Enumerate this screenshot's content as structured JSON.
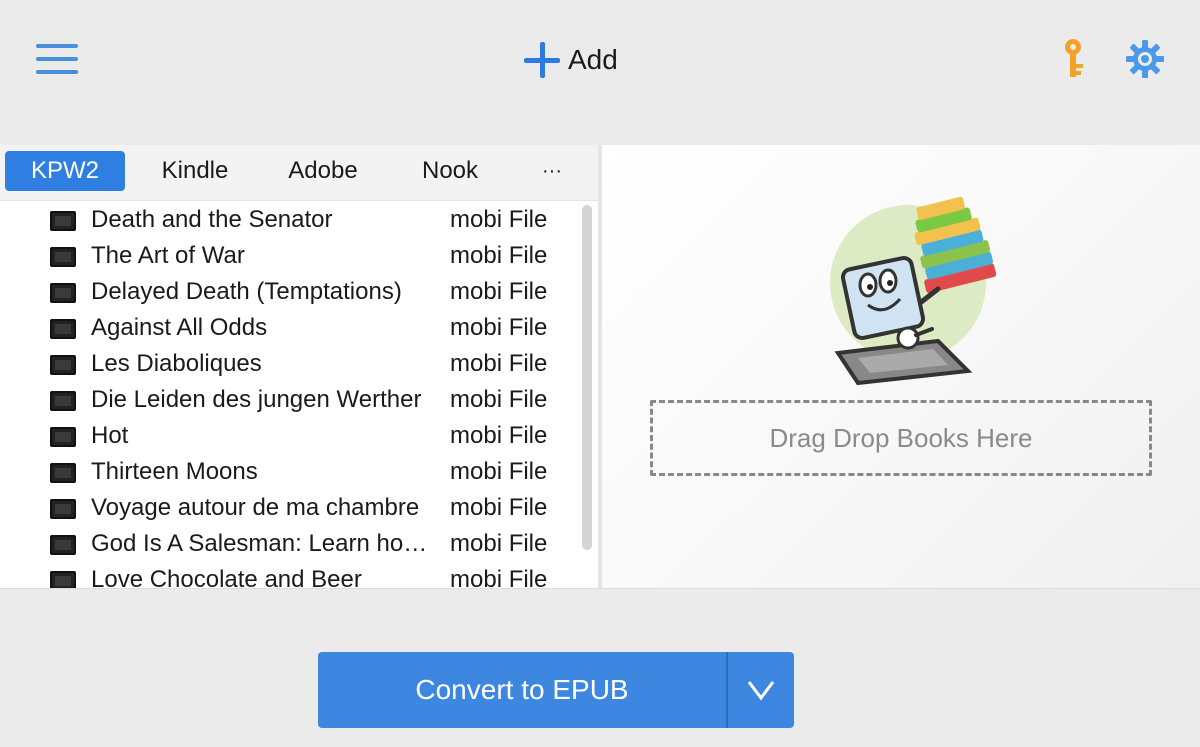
{
  "toolbar": {
    "menu_icon": "hamburger-menu-icon",
    "add_label": "Add",
    "add_icon": "plus-icon",
    "license_icon": "key-icon",
    "settings_icon": "gear-icon",
    "accent_color": "#2e7ae0",
    "key_color": "#f2a227"
  },
  "tabs": [
    {
      "label": "KPW2",
      "active": true
    },
    {
      "label": "Kindle",
      "active": false
    },
    {
      "label": "Adobe",
      "active": false
    },
    {
      "label": "Nook",
      "active": false
    },
    {
      "label": "···",
      "active": false
    }
  ],
  "books": [
    {
      "title": "Death and the Senator",
      "type": "mobi File"
    },
    {
      "title": "The Art of War",
      "type": "mobi File"
    },
    {
      "title": "Delayed Death (Temptations)",
      "type": "mobi File"
    },
    {
      "title": "Against All Odds",
      "type": "mobi File"
    },
    {
      "title": "Les Diaboliques",
      "type": "mobi File"
    },
    {
      "title": "Die Leiden des jungen Werther",
      "type": "mobi File"
    },
    {
      "title": "Hot",
      "type": "mobi File"
    },
    {
      "title": "Thirteen Moons",
      "type": "mobi File"
    },
    {
      "title": "Voyage autour de ma chambre",
      "type": "mobi File"
    },
    {
      "title": "God Is A Salesman: Learn how to sell",
      "type": "mobi File"
    },
    {
      "title": "Love Chocolate and Beer",
      "type": "mobi File"
    }
  ],
  "drop_zone": {
    "label": "Drag Drop Books Here",
    "illustration": "laptop-with-books-illustration"
  },
  "convert": {
    "label": "Convert to EPUB",
    "dropdown_icon": "chevron-down-icon",
    "color": "#3d87e0"
  }
}
